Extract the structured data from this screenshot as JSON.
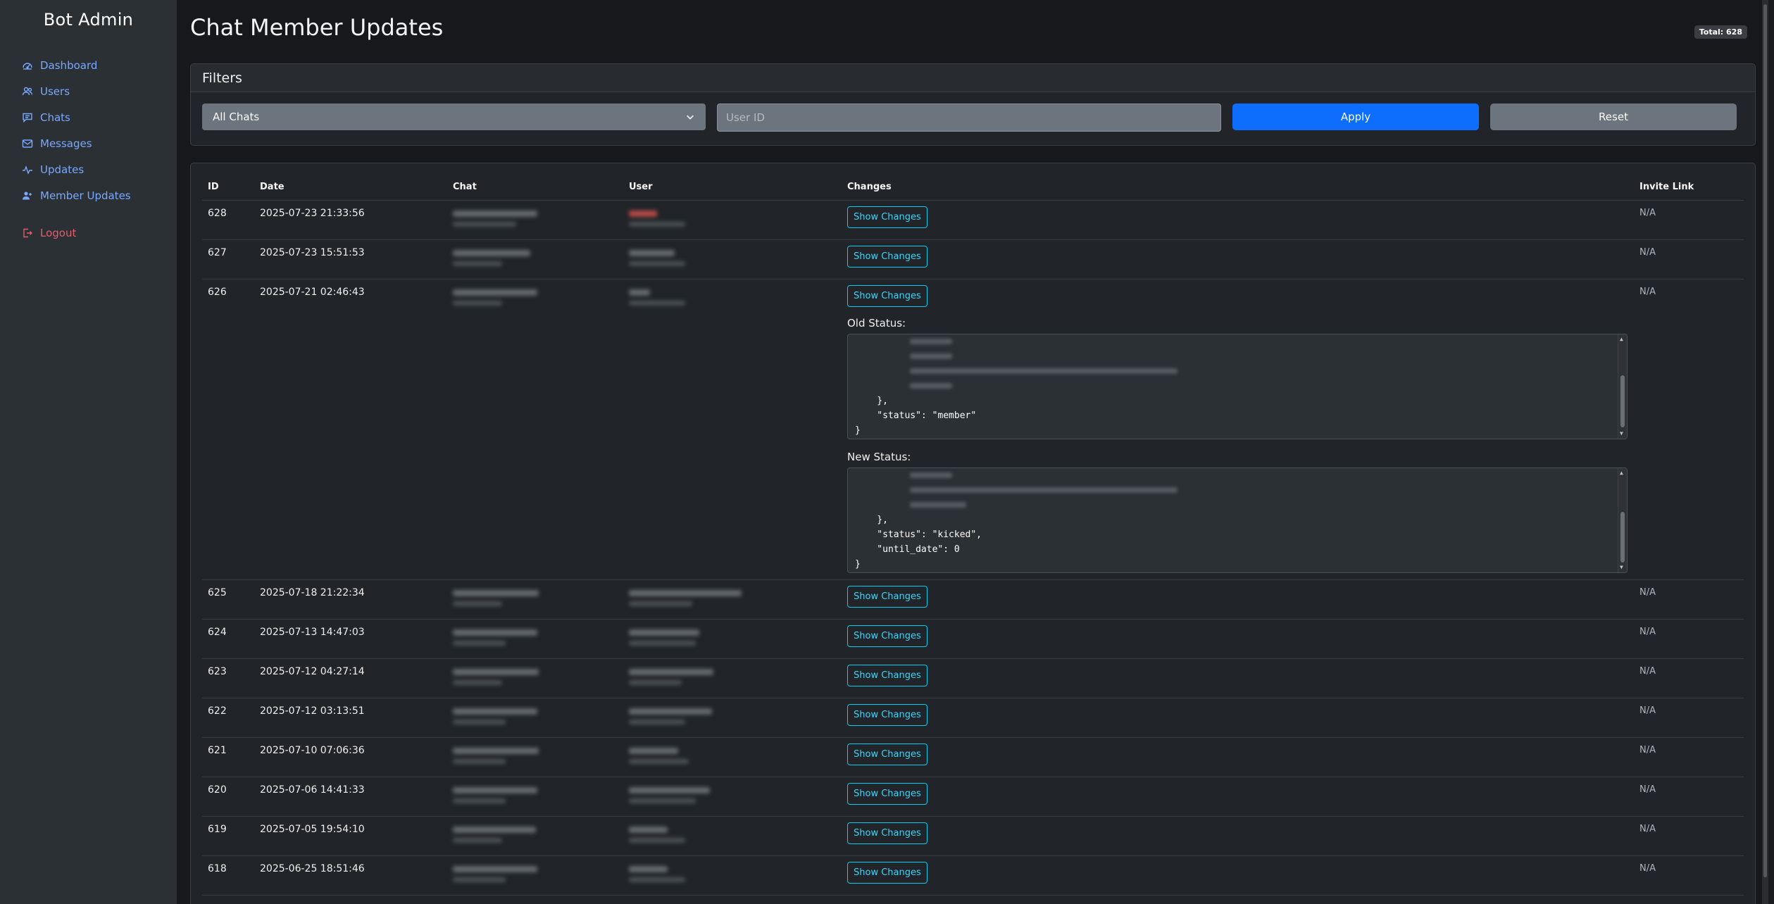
{
  "sidebar": {
    "brand": "Bot Admin",
    "items": [
      {
        "label": "Dashboard",
        "icon": "dashboard-icon"
      },
      {
        "label": "Users",
        "icon": "users-icon"
      },
      {
        "label": "Chats",
        "icon": "chat-icon"
      },
      {
        "label": "Messages",
        "icon": "envelope-icon"
      },
      {
        "label": "Updates",
        "icon": "activity-icon"
      },
      {
        "label": "Member Updates",
        "icon": "member-updates-icon"
      }
    ],
    "logout": {
      "label": "Logout",
      "icon": "logout-icon"
    }
  },
  "page": {
    "title": "Chat Member Updates",
    "total_badge": "Total: 628"
  },
  "filters": {
    "title": "Filters",
    "chat_select_value": "All Chats",
    "user_id_placeholder": "User ID",
    "apply_label": "Apply",
    "reset_label": "Reset"
  },
  "table": {
    "headers": {
      "id": "ID",
      "date": "Date",
      "chat": "Chat",
      "user": "User",
      "changes": "Changes",
      "invite_link": "Invite Link"
    },
    "show_changes_label": "Show Changes",
    "rows": [
      {
        "id": "628",
        "date": "2025-07-23 21:33:56",
        "invite": "N/A"
      },
      {
        "id": "627",
        "date": "2025-07-23 15:51:53",
        "invite": "N/A"
      },
      {
        "id": "626",
        "date": "2025-07-21 02:46:43",
        "invite": "N/A"
      },
      {
        "id": "625",
        "date": "2025-07-18 21:22:34",
        "invite": "N/A"
      },
      {
        "id": "624",
        "date": "2025-07-13 14:47:03",
        "invite": "N/A"
      },
      {
        "id": "623",
        "date": "2025-07-12 04:27:14",
        "invite": "N/A"
      },
      {
        "id": "622",
        "date": "2025-07-12 03:13:51",
        "invite": "N/A"
      },
      {
        "id": "621",
        "date": "2025-07-10 07:06:36",
        "invite": "N/A"
      },
      {
        "id": "620",
        "date": "2025-07-06 14:41:33",
        "invite": "N/A"
      },
      {
        "id": "619",
        "date": "2025-07-05 19:54:10",
        "invite": "N/A"
      },
      {
        "id": "618",
        "date": "2025-06-25 18:51:46",
        "invite": "N/A"
      }
    ],
    "expanded": {
      "old_label": "Old Status:",
      "old_lines": [
        "    },",
        "    \"status\": \"member\"",
        "}"
      ],
      "new_label": "New Status:",
      "new_lines": [
        "    },",
        "    \"status\": \"kicked\",",
        "    \"until_date\": 0",
        "}"
      ]
    }
  },
  "colors": {
    "sidebar_bg": "#2b3035",
    "link": "#79a8ff",
    "logout": "#e35d6a",
    "primary": "#0d6efd",
    "secondary": "#6c757d",
    "info_outline": "#0dcaf0"
  }
}
